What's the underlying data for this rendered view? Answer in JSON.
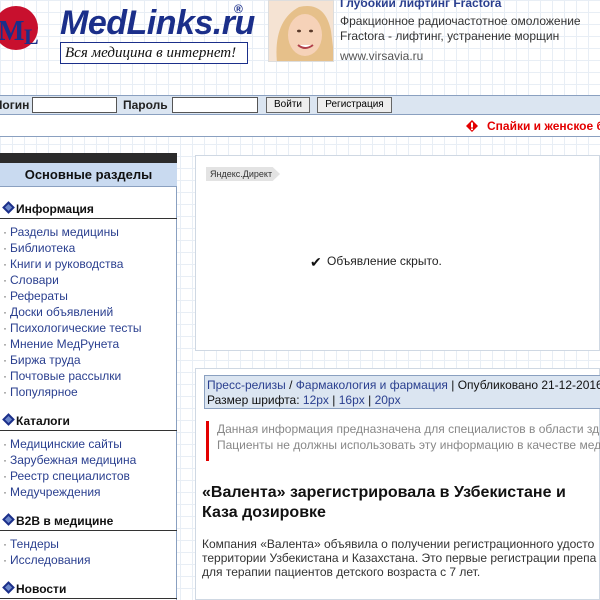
{
  "header": {
    "logo_text": "MedLinks.ru",
    "logo_reg": "®",
    "logo_tagline": "Вся медицина в интернет!",
    "ad": {
      "title": "Глубокий лифтинг Fractora",
      "text": "Фракционное радиочастотное омоложение Fractora - лифтинг, устранение морщин",
      "url": "www.virsavia.ru"
    }
  },
  "login_bar": {
    "login_label": "Логин",
    "password_label": "Пароль",
    "login_button": "Войти",
    "register_button": "Регистрация"
  },
  "promo": {
    "text": "Спайки и женское б"
  },
  "sidebar": {
    "title": "Основные разделы",
    "sections": [
      {
        "heading": "Информация",
        "items": [
          "Разделы медицины",
          "Библиотека",
          "Книги и руководства",
          "Словари",
          "Рефераты",
          "Доски объявлений",
          "Психологические тесты",
          "Мнение МедРунета",
          "Биржа труда",
          "Почтовые рассылки",
          "Популярное"
        ]
      },
      {
        "heading": "Каталоги",
        "items": [
          "Медицинские сайты",
          "Зарубежная медицина",
          "Реестр специалистов",
          "Медучреждения"
        ]
      },
      {
        "heading": "B2B в медицине",
        "items": [
          "Тендеры",
          "Исследования"
        ]
      },
      {
        "heading": "Новости",
        "items": []
      }
    ]
  },
  "direct": {
    "tag": "Яндекс.Директ",
    "hidden_check": "✔",
    "hidden_text": "Объявление скрыто."
  },
  "article": {
    "breadcrumb": {
      "link1": "Пресс-релизы",
      "sep": " / ",
      "link2": "Фармакология и фармация",
      "published": " | Опубликовано 21-12-2016",
      "font_label": "Размер шрифта: ",
      "font_12": "12px",
      "font_16": "16px",
      "font_20": "20px",
      "pipe": " | "
    },
    "notice_line1": "Данная информация предназначена для специалистов в области зд",
    "notice_line2": "Пациенты не должны использовать эту информацию в качестве мед",
    "title": "«Валента» зарегистрировала в Узбекистане и Каза дозировке",
    "body": "Компания «Валента» объявила о получении регистрационного удосто территории Узбекистана и Казахстана. Это первые регистрации препа для терапии пациентов детского возраста с 7 лет."
  },
  "colors": {
    "brand": "#1b2f8a",
    "link": "#2a3f8f",
    "bar": "#dbe5f1",
    "accent_red": "#e30000"
  }
}
